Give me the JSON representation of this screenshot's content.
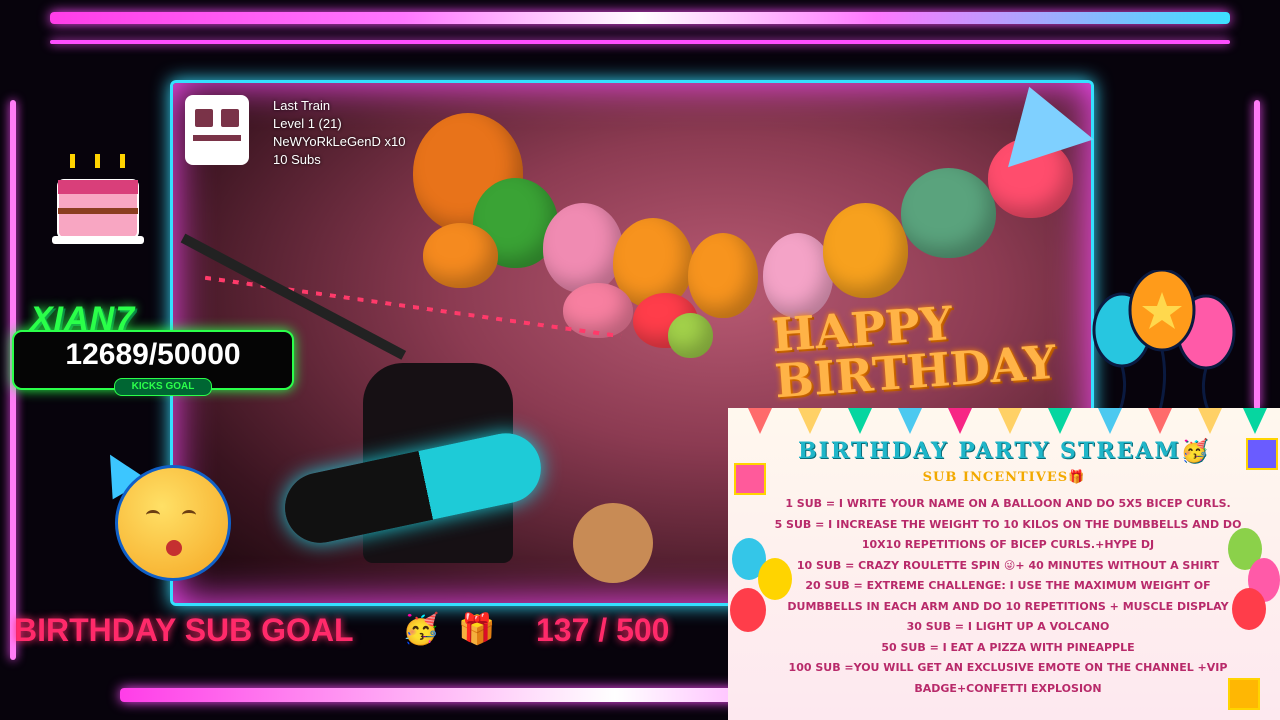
{
  "last_train": {
    "title": "Last Train",
    "level": "Level 1  (21)",
    "user": "NeWYoRkLeGenD x10",
    "subs": "10 Subs"
  },
  "kicks_goal": {
    "brand": "XIAN7",
    "count": "12689/50000",
    "label": "KICKS GOAL"
  },
  "birthday_sub_goal": {
    "label": "BIRTHDAY SUB GOAL",
    "emoji_party": "🥳",
    "emoji_gift": "🎁",
    "progress": "137 / 500"
  },
  "video": {
    "banner_text": "HAPPY BIRTHDAY"
  },
  "incentives": {
    "title": "BIRTHDAY PARTY STREAM🥳",
    "subtitle": "SUB INCENTIVES🎁",
    "items": [
      "1 SUB = I WRITE YOUR NAME ON A BALLOON AND DO 5X5 BICEP CURLS.",
      "5 SUB = I INCREASE THE WEIGHT TO 10 KILOS ON THE DUMBBELLS AND DO 10X10 REPETITIONS OF BICEP CURLS.+HYPE DJ",
      "10 SUB = CRAZY ROULETTE SPIN 😜+ 40 MINUTES WITHOUT A SHIRT",
      "20 SUB = EXTREME CHALLENGE: I USE THE MAXIMUM WEIGHT OF DUMBBELLS IN EACH ARM AND DO 10 REPETITIONS + MUSCLE DISPLAY",
      "30 SUB = I LIGHT UP A VOLCANO",
      "50 SUB = I EAT A PIZZA WITH PINEAPPLE",
      "100 SUB =YOU WILL GET AN EXCLUSIVE EMOTE ON THE CHANNEL +VIP BADGE+CONFETTI EXPLOSION"
    ]
  },
  "colors": {
    "neon_pink": "#ff4dff",
    "neon_cyan": "#35e0ff",
    "neon_green": "#2bff4a",
    "goal_red": "#ff2a6a"
  }
}
